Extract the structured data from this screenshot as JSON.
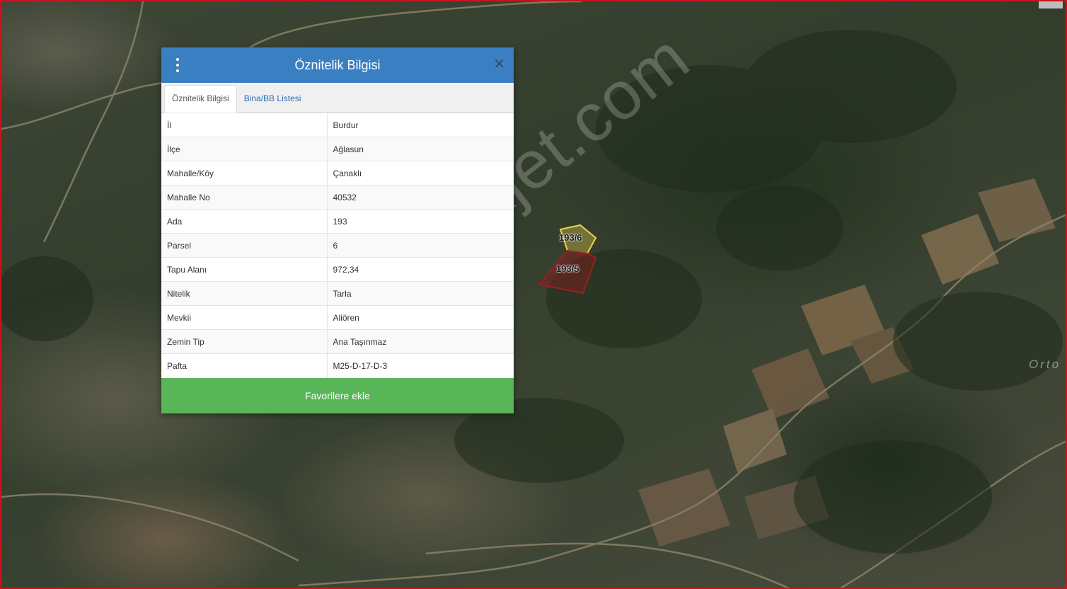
{
  "popup": {
    "title": "Öznitelik Bilgisi",
    "tabs": [
      {
        "label": "Öznitelik Bilgisi",
        "active": true
      },
      {
        "label": "Bina/BB Listesi",
        "active": false
      }
    ],
    "rows": [
      {
        "key": "İl",
        "value": "Burdur"
      },
      {
        "key": "İlçe",
        "value": "Ağlasun"
      },
      {
        "key": "Mahalle/Köy",
        "value": "Çanaklı"
      },
      {
        "key": "Mahalle No",
        "value": "40532"
      },
      {
        "key": "Ada",
        "value": "193"
      },
      {
        "key": "Parsel",
        "value": "6"
      },
      {
        "key": "Tapu Alanı",
        "value": "972,34"
      },
      {
        "key": "Nitelik",
        "value": "Tarla"
      },
      {
        "key": "Mevkii",
        "value": "Aliören"
      },
      {
        "key": "Zemin Tip",
        "value": "Ana Taşınmaz"
      },
      {
        "key": "Pafta",
        "value": "M25-D-17-D-3"
      }
    ],
    "favorite_label": "Favorilere ekle"
  },
  "map": {
    "parcels": [
      {
        "label": "193/6",
        "color": "#e8d44a"
      },
      {
        "label": "193/5",
        "color": "#8b1a1a"
      }
    ],
    "place_label": "Orto",
    "watermark": "emlakjet.com"
  },
  "icons": {
    "menu": "vertical-dots-icon",
    "close": "close-icon"
  },
  "colors": {
    "header": "#3a7fc1",
    "favorite_button": "#58b658",
    "border": "#c8141e"
  }
}
